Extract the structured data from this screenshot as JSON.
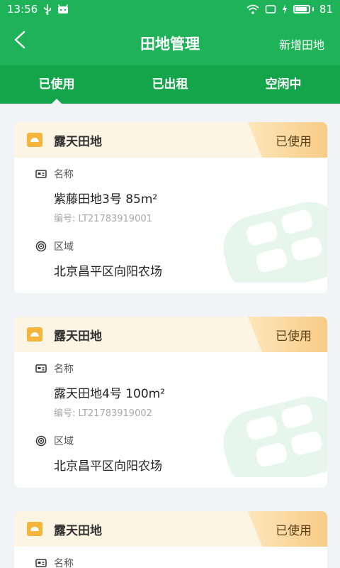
{
  "status_bar": {
    "time": "13:56",
    "battery_level": "81",
    "battery_fraction": 0.81
  },
  "header": {
    "title": "田地管理",
    "action_label": "新增田地"
  },
  "tabs": [
    {
      "label": "已使用",
      "active": true
    },
    {
      "label": "已出租",
      "active": false
    },
    {
      "label": "空闲中",
      "active": false
    }
  ],
  "fields": [
    {
      "type": "露天田地",
      "status": "已使用",
      "name_label": "名称",
      "name": "紫藤田地3号   85m²",
      "code": "编号: LT21783919001",
      "region_label": "区域",
      "region": "北京昌平区向阳农场"
    },
    {
      "type": "露天田地",
      "status": "已使用",
      "name_label": "名称",
      "name": "露天田地4号   100m²",
      "code": "编号: LT21783919002",
      "region_label": "区域",
      "region": "北京昌平区向阳农场"
    },
    {
      "type": "露天田地",
      "status": "已使用",
      "name_label": "名称",
      "name": "",
      "code": "",
      "region_label": "",
      "region": ""
    }
  ],
  "colors": {
    "primary": "#1fb359",
    "tab_bg": "#14a54b",
    "card_header_bg": "#fdf5e4",
    "status_badge": "#f8cc87",
    "icon_yellow": "#f5b53d"
  }
}
